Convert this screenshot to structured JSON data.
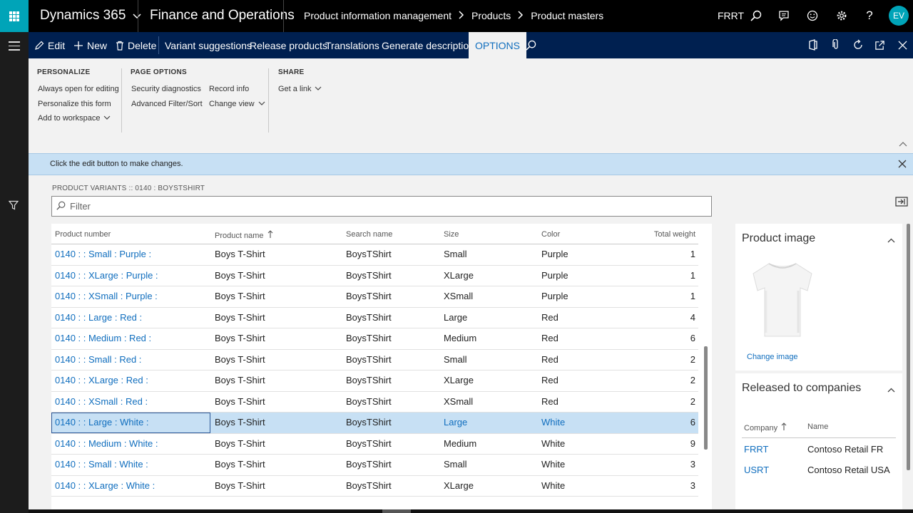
{
  "topbar": {
    "brand": "Dynamics 365",
    "app_name": "Finance and Operations",
    "breadcrumbs": [
      "Product information management",
      "Products",
      "Product masters"
    ],
    "company": "FRRT",
    "user_initials": "EV"
  },
  "actionpane": {
    "edit": "Edit",
    "new": "New",
    "delete": "Delete",
    "variant_suggestions": "Variant suggestions",
    "release_products": "Release products",
    "translations": "Translations",
    "generate_descriptions": "Generate descriptions",
    "options": "OPTIONS"
  },
  "ribbon": {
    "personalize": {
      "title": "PERSONALIZE",
      "items": [
        "Always open for editing",
        "Personalize this form",
        "Add to workspace"
      ]
    },
    "page_options": {
      "title": "PAGE OPTIONS",
      "col1": [
        "Security diagnostics",
        "Advanced Filter/Sort"
      ],
      "col2": [
        "Record info",
        "Change view"
      ]
    },
    "share": {
      "title": "SHARE",
      "items": [
        "Get a link"
      ]
    }
  },
  "message": "Click the edit button to make changes.",
  "grid": {
    "caption": "PRODUCT VARIANTS :: 0140 : BOYSTSHIRT",
    "filter_placeholder": "Filter",
    "columns": [
      "Product number",
      "Product name",
      "Search name",
      "Size",
      "Color",
      "Total weight"
    ],
    "rows": [
      [
        "0140 :  : Small : Purple :",
        "Boys T-Shirt",
        "BoysTShirt",
        "Small",
        "Purple",
        "1"
      ],
      [
        "0140 :  : XLarge : Purple :",
        "Boys T-Shirt",
        "BoysTShirt",
        "XLarge",
        "Purple",
        "1"
      ],
      [
        "0140 :  : XSmall : Purple :",
        "Boys T-Shirt",
        "BoysTShirt",
        "XSmall",
        "Purple",
        "1"
      ],
      [
        "0140 :  : Large : Red :",
        "Boys T-Shirt",
        "BoysTShirt",
        "Large",
        "Red",
        "4"
      ],
      [
        "0140 :  : Medium : Red :",
        "Boys T-Shirt",
        "BoysTShirt",
        "Medium",
        "Red",
        "6"
      ],
      [
        "0140 :  : Small : Red :",
        "Boys T-Shirt",
        "BoysTShirt",
        "Small",
        "Red",
        "2"
      ],
      [
        "0140 :  : XLarge : Red :",
        "Boys T-Shirt",
        "BoysTShirt",
        "XLarge",
        "Red",
        "2"
      ],
      [
        "0140 :  : XSmall : Red :",
        "Boys T-Shirt",
        "BoysTShirt",
        "XSmall",
        "Red",
        "2"
      ],
      [
        "0140 :  : Large : White :",
        "Boys T-Shirt",
        "BoysTShirt",
        "Large",
        "White",
        "6"
      ],
      [
        "0140 :  : Medium : White :",
        "Boys T-Shirt",
        "BoysTShirt",
        "Medium",
        "White",
        "9"
      ],
      [
        "0140 :  : Small : White :",
        "Boys T-Shirt",
        "BoysTShirt",
        "Small",
        "White",
        "3"
      ],
      [
        "0140 :  : XLarge : White :",
        "Boys T-Shirt",
        "BoysTShirt",
        "XLarge",
        "White",
        "3"
      ]
    ],
    "selected_row": 8
  },
  "factbox": {
    "product_image": {
      "title": "Product image",
      "change_image": "Change image"
    },
    "released": {
      "title": "Released to companies",
      "columns": [
        "Company",
        "Name"
      ],
      "rows": [
        [
          "FRRT",
          "Contoso Retail FR"
        ],
        [
          "USRT",
          "Contoso Retail USA"
        ]
      ]
    }
  },
  "colors": {
    "accent": "#00a4b8",
    "action_pane": "#002050",
    "link": "#106ebe",
    "selection": "#c7e0f4"
  }
}
